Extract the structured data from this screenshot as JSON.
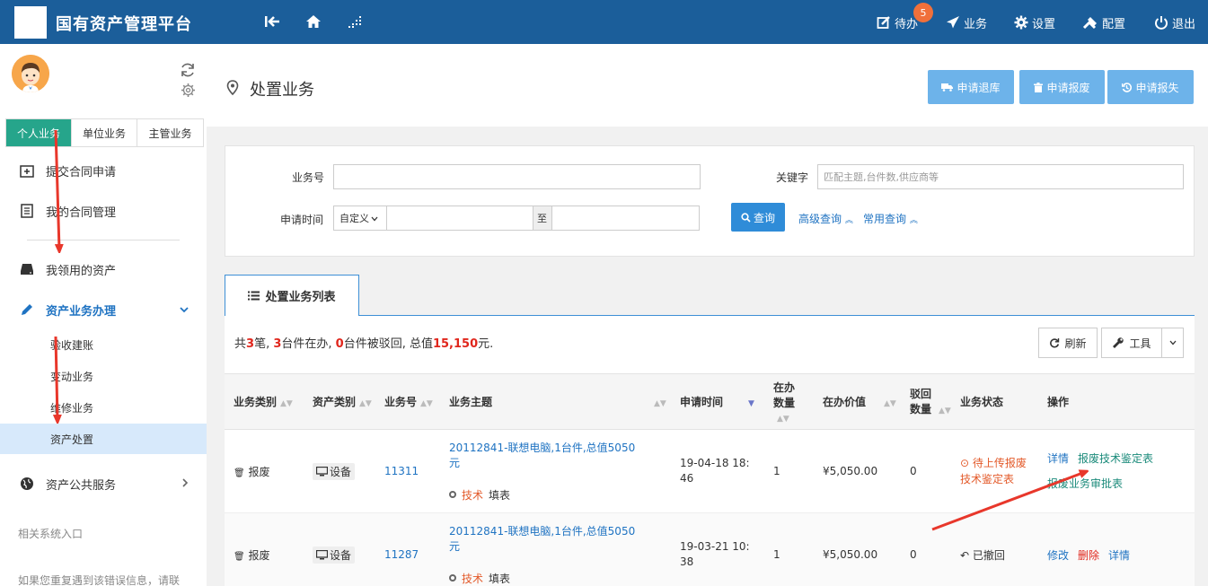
{
  "topbar": {
    "title": "国有资产管理平台",
    "todo_label": "待办",
    "todo_count": "5",
    "business_label": "业务",
    "settings_label": "设置",
    "config_label": "配置",
    "logout_label": "退出"
  },
  "sidebar": {
    "tabs": [
      "个人业务",
      "单位业务",
      "主管业务"
    ],
    "items": {
      "submit_contract": "提交合同申请",
      "my_contracts": "我的合同管理",
      "my_assets": "我领用的资产",
      "asset_business": "资产业务办理",
      "public_service": "资产公共服务"
    },
    "sub_items": [
      "验收建账",
      "变动业务",
      "维修业务",
      "资产处置"
    ],
    "related_entry": "相关系统入口",
    "note": "如果您重复遇到该错误信息，请联"
  },
  "page": {
    "title": "处置业务",
    "buttons": [
      "申请退库",
      "申请报废",
      "申请报失"
    ]
  },
  "search": {
    "business_no_label": "业务号",
    "keyword_label": "关键字",
    "keyword_placeholder": "匹配主题,台件数,供应商等",
    "date_label": "申请时间",
    "date_mode": "自定义",
    "date_sep": "至",
    "search_button": "查询",
    "advanced": "高级查询",
    "common": "常用查询"
  },
  "list": {
    "tab_label": "处置业务列表",
    "summary": {
      "p1": "共",
      "n1": "3",
      "p2": "笔, ",
      "n2": "3",
      "p3": "台件在办, ",
      "n3": "0",
      "p4": "台件被驳回, 总值",
      "n4": "15,150",
      "p5": "元."
    },
    "refresh": "刷新",
    "tools": "工具",
    "columns": [
      "业务类别",
      "资产类别",
      "业务号",
      "业务主题",
      "申请时间",
      "在办数量",
      "在办价值",
      "驳回数量",
      "业务状态",
      "操作"
    ],
    "rows": [
      {
        "category": "报废",
        "asset_type": "设备",
        "business_no": "11311",
        "subject": "20112841-联想电脑,1台件,总值5050元",
        "meta_role": "技术",
        "meta_action": "填表",
        "apply_time": "19-04-18 18:46",
        "count": "1",
        "value": "¥5,050.00",
        "rejected": "0",
        "status": "待上传报废技术鉴定表",
        "ops": [
          "详情",
          "报废技术鉴定表",
          "报废业务审批表"
        ]
      },
      {
        "category": "报废",
        "asset_type": "设备",
        "business_no": "11287",
        "subject": "20112841-联想电脑,1台件,总值5050元",
        "meta_role": "技术",
        "meta_action": "填表",
        "apply_time": "19-03-21 10:38",
        "count": "1",
        "value": "¥5,050.00",
        "rejected": "0",
        "status": "已撤回",
        "ops": [
          "修改",
          "删除",
          "详情"
        ]
      }
    ]
  },
  "colors": {
    "topbar": "#1b5e9a",
    "active_tab": "#26a58b",
    "link": "#1f73c2",
    "danger": "#e0261c",
    "arrow": "#e8372b"
  }
}
